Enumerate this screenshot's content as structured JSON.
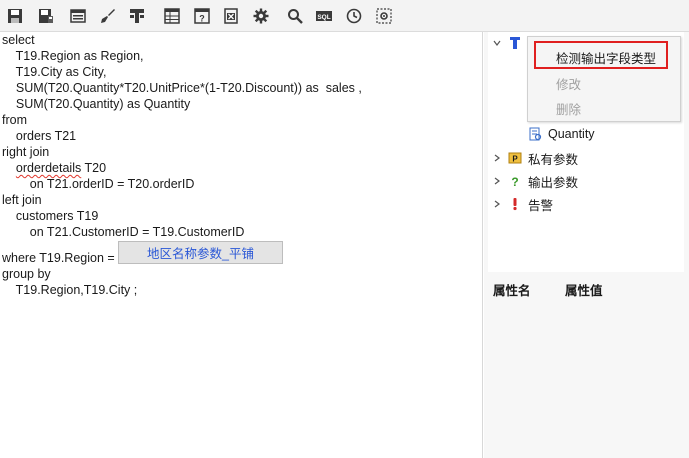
{
  "toolbar": {
    "buttons": [
      {
        "name": "save-icon"
      },
      {
        "name": "save-as-icon"
      },
      {
        "name": "window-icon"
      },
      {
        "name": "brush-icon"
      },
      {
        "name": "hierarchy-icon"
      },
      {
        "name": "table-icon"
      },
      {
        "name": "query-help-icon"
      },
      {
        "name": "excel-icon"
      },
      {
        "name": "gear-icon"
      },
      {
        "name": "search-icon"
      },
      {
        "name": "sql-icon"
      },
      {
        "name": "clock-icon"
      },
      {
        "name": "settings-box-icon"
      }
    ],
    "sql_label": "SQL"
  },
  "editor": {
    "lines": [
      "select",
      "    T19.Region as Region,",
      "    T19.City as City,",
      "    SUM(T20.Quantity*T20.UnitPrice*(1-T20.Discount)) as  sales ,",
      "    SUM(T20.Quantity) as Quantity",
      "from",
      "    orders T21",
      "right join",
      "    ",
      "        on T21.orderID = T20.orderID",
      "left join",
      "    customers T19",
      "        on T21.CustomerID = T19.CustomerID",
      "where T19.Region = ",
      "group by",
      "    T19.Region,T19.City ;"
    ],
    "orderdetails_word": "orderdetails",
    "orderdetails_rest": " T20",
    "param_widget": "地区名称参数_平铺"
  },
  "tree": {
    "quantity": "Quantity",
    "private_params": "私有参数",
    "output_params": "输出参数",
    "alerts": "告警"
  },
  "context_menu": {
    "detect": "检测输出字段类型",
    "edit": "修改",
    "delete": "删除"
  },
  "properties": {
    "name_header": "属性名",
    "value_header": "属性值"
  },
  "colors": {
    "highlight_border": "#e02020",
    "param_text": "#2a57d6",
    "squiggle": "#e0352b"
  }
}
